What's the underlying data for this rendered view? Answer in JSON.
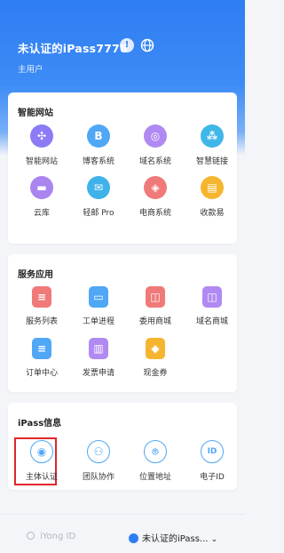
{
  "header": {
    "username": "未认证的iPass7776",
    "role": "主用户",
    "info_icon": "exclamation-icon",
    "globe_icon": "globe-icon"
  },
  "sections": [
    {
      "title": "智能网站",
      "items": [
        {
          "label": "智能网站",
          "icon": "smart-site-icon",
          "color": "#8b7cf6"
        },
        {
          "label": "博客系统",
          "icon": "blog-icon",
          "color": "#4fa7f5"
        },
        {
          "label": "域名系统",
          "icon": "domain-icon",
          "color": "#b08af2"
        },
        {
          "label": "智慧链接",
          "icon": "link-icon",
          "color": "#3fb7e8"
        },
        {
          "label": "云库",
          "icon": "folder-icon",
          "color": "#a985f0"
        },
        {
          "label": "轻邮 Pro",
          "icon": "mail-icon",
          "color": "#3fb2ea"
        },
        {
          "label": "电商系统",
          "icon": "shop-icon",
          "color": "#f07a79"
        },
        {
          "label": "收款易",
          "icon": "wallet-icon",
          "color": "#f6b52e"
        }
      ]
    },
    {
      "title": "服务应用",
      "items": [
        {
          "label": "服务列表",
          "icon": "service-list-icon",
          "color": "#f07a79"
        },
        {
          "label": "工单进程",
          "icon": "ticket-icon",
          "color": "#4fa7f5"
        },
        {
          "label": "委用商城",
          "icon": "mall-icon",
          "color": "#f07a79"
        },
        {
          "label": "域名商城",
          "icon": "domain-mall-icon",
          "color": "#b08af2"
        },
        {
          "label": "订单中心",
          "icon": "order-icon",
          "color": "#4fa7f5"
        },
        {
          "label": "发票申请",
          "icon": "invoice-icon",
          "color": "#b08af2"
        },
        {
          "label": "现金券",
          "icon": "coupon-icon",
          "color": "#f6b52e"
        }
      ]
    },
    {
      "title": "iPass信息",
      "items": [
        {
          "label": "主体认证",
          "icon": "identity-icon",
          "color": "#4fa7f5"
        },
        {
          "label": "团队协作",
          "icon": "team-icon",
          "color": "#4fa7f5"
        },
        {
          "label": "位置地址",
          "icon": "location-icon",
          "color": "#4fa7f5"
        },
        {
          "label": "电子ID",
          "icon": "id-icon",
          "color": "#4fa7f5"
        }
      ]
    }
  ],
  "footer": {
    "left_label": "iYong  ID",
    "right_label": "未认证的iPass..."
  }
}
